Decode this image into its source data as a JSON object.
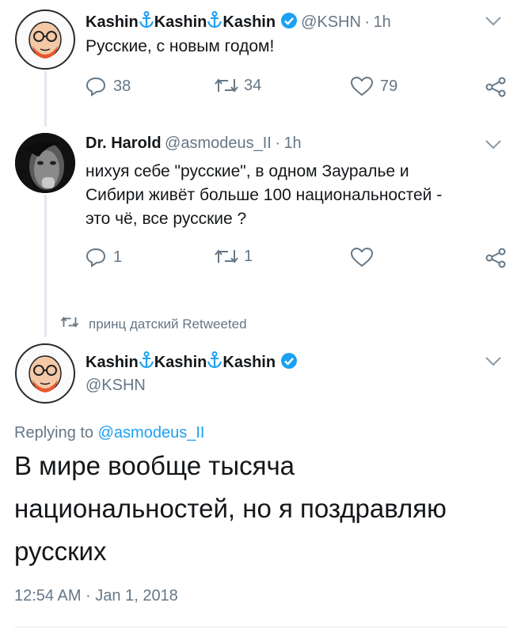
{
  "tweet1": {
    "display_name": [
      "Kashin",
      "Kashin",
      "Kashin"
    ],
    "handle": "@KSHN",
    "time": "1h",
    "text": "Русские, с новым годом!",
    "replies": "38",
    "retweets": "34",
    "likes": "79"
  },
  "tweet2": {
    "display_name": "Dr. Harold",
    "handle": "@asmodeus_II",
    "time": "1h",
    "text_lines": [
      "нихуя себе \"русские\", в одном Зауралье и",
      "Сибири живёт больше 100 национальностей -",
      "это чё, все русские ?"
    ],
    "replies": "1",
    "retweets": "1"
  },
  "retweeted_by": "принц датский Retweeted",
  "tweet3": {
    "display_name": [
      "Kashin",
      "Kashin",
      "Kashin"
    ],
    "handle": "@KSHN",
    "replying_prefix": "Replying to",
    "replying_to": "@asmodeus_II",
    "text_lines": [
      "В мире вообще тысяча",
      "национальностей, но я поздравляю",
      "русских"
    ],
    "timestamp": "12:54 AM · Jan 1, 2018"
  },
  "colors": {
    "verified": "#1da1f2",
    "link": "#1da1f2",
    "secondary_text": "#657786",
    "anchor": "#1da1f2"
  },
  "icons": [
    "verified-icon",
    "anchor-icon",
    "reply-icon",
    "retweet-icon",
    "like-icon",
    "share-icon",
    "chevron-down-icon"
  ]
}
